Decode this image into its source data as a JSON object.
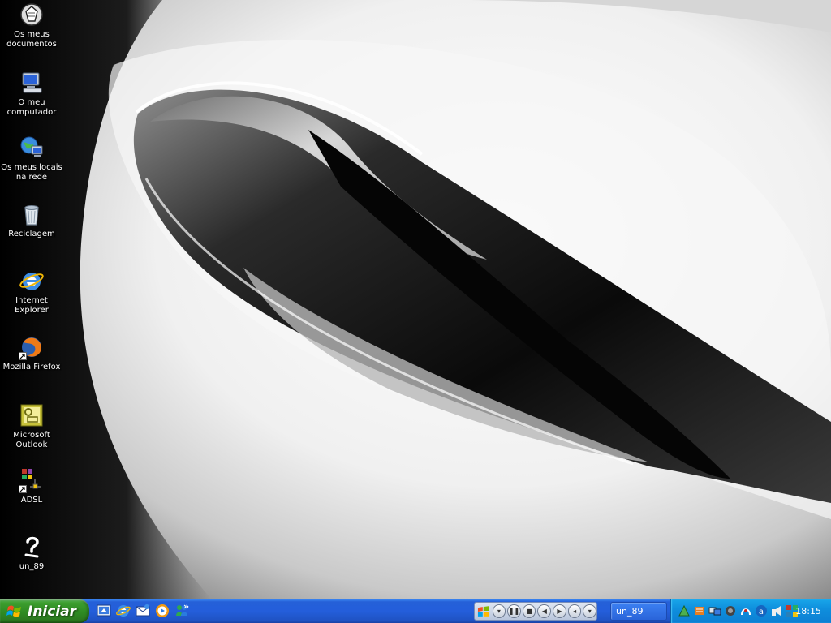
{
  "desktop": {
    "icons": [
      {
        "label": "Os meus documentos",
        "icon": "my-documents-icon"
      },
      {
        "label": "O meu computador",
        "icon": "my-computer-icon"
      },
      {
        "label": "Os meus locais na rede",
        "icon": "network-places-icon"
      },
      {
        "label": "Reciclagem",
        "icon": "recycle-bin-icon"
      },
      {
        "label": "Internet Explorer",
        "icon": "internet-explorer-icon"
      },
      {
        "label": "Mozilla Firefox",
        "icon": "firefox-icon"
      },
      {
        "label": "Microsoft Outlook",
        "icon": "outlook-icon"
      },
      {
        "label": "ADSL",
        "icon": "adsl-icon"
      },
      {
        "label": "un_89",
        "icon": "unknown-file-icon"
      }
    ]
  },
  "taskbar": {
    "start_label": "Iniciar",
    "quick_launch": [
      "show-desktop-icon",
      "internet-explorer-icon",
      "outlook-express-icon",
      "media-player-icon",
      "messenger-icon"
    ],
    "chevron": "»",
    "media_controls": [
      "play-pause-icon",
      "stop-icon",
      "previous-icon",
      "next-icon",
      "volume-icon"
    ],
    "task_button_label": "un_89",
    "tray_icons": [
      "tray-icon-1",
      "tray-icon-2",
      "tray-icon-3",
      "tray-icon-4",
      "tray-icon-5",
      "tray-icon-6",
      "tray-icon-7",
      "tray-icon-8"
    ],
    "clock": "18:15"
  },
  "colors": {
    "taskbar": "#245edb",
    "start_button": "#2e8b23",
    "tray": "#0f8fdd"
  }
}
